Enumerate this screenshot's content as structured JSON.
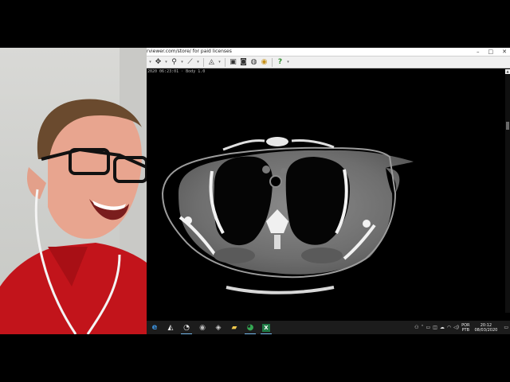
{
  "viewer": {
    "title": "rviewer.com/store/ for paid licenses",
    "window_controls": {
      "minimize": "–",
      "maximize": "□",
      "close": "✕"
    },
    "info_text": "2020 06:23:01 · Body 1.0"
  },
  "toolbar": {
    "tools": [
      {
        "icon": "hand-pan-icon",
        "glyph": "✥"
      },
      {
        "icon": "zoom-icon",
        "glyph": "⚲"
      },
      {
        "icon": "measure-icon",
        "glyph": "⟋"
      },
      {
        "icon": "windowing-icon",
        "glyph": "◬"
      },
      {
        "icon": "image-export-icon",
        "glyph": "▣"
      },
      {
        "icon": "film-icon",
        "glyph": "◙"
      },
      {
        "icon": "globe-icon",
        "glyph": "◍"
      },
      {
        "icon": "coin-icon",
        "glyph": "◉"
      },
      {
        "icon": "help-icon",
        "glyph": "?"
      }
    ]
  },
  "taskbar": {
    "apps": [
      {
        "icon": "edge-icon",
        "glyph": "e",
        "color": "#3b8fd9"
      },
      {
        "icon": "photos-icon",
        "glyph": "◭",
        "color": "#e8e8e8"
      },
      {
        "icon": "clock-app-icon",
        "glyph": "◔",
        "color": "#e8e8e8"
      },
      {
        "icon": "obs-icon",
        "glyph": "◉",
        "color": "#bcbcbc"
      },
      {
        "icon": "viewer-app-icon",
        "glyph": "◈",
        "color": "#cfcfcf"
      },
      {
        "icon": "file-explorer-icon",
        "glyph": "▰",
        "color": "#f2c94c"
      },
      {
        "icon": "chrome-icon",
        "glyph": "◕",
        "color": "#34a853"
      },
      {
        "icon": "excel-icon",
        "glyph": "X",
        "color": "#1f7a45"
      }
    ],
    "tray": {
      "language_top": "POR",
      "language_bottom": "PTB",
      "time": "20:12",
      "date": "08/03/2020"
    }
  }
}
